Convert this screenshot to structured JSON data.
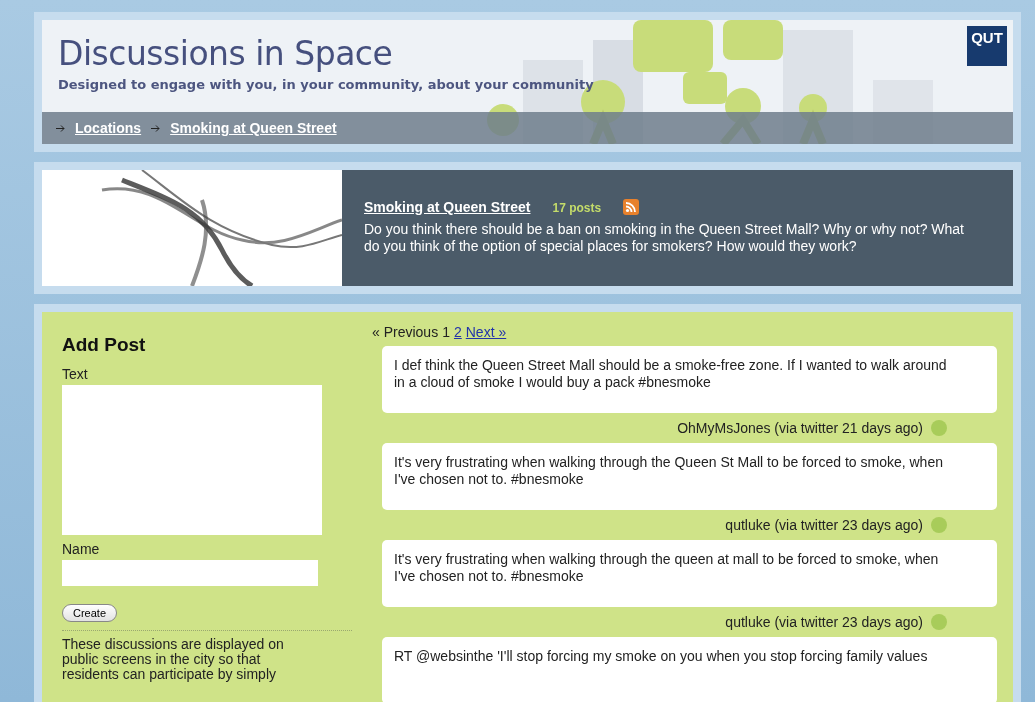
{
  "header": {
    "title": "Discussions in Space",
    "tagline": "Designed to engage with you, in your community, about your community",
    "logo": "QUT"
  },
  "breadcrumbs": [
    {
      "label": "Locations"
    },
    {
      "label": "Smoking at Queen Street"
    }
  ],
  "topic": {
    "title": "Smoking at Queen Street",
    "post_count": "17 posts",
    "question": "Do you think there should be a ban on smoking in the Queen Street Mall? Why or why not? What do you think of the option of special places for smokers? How would they work?"
  },
  "add_post": {
    "heading": "Add Post",
    "fields": [
      {
        "label": "Text",
        "kind": "textarea"
      },
      {
        "label": "Name",
        "kind": "input"
      }
    ],
    "button": "Create",
    "info": "These discussions are displayed on public screens in the city so that residents can participate by simply"
  },
  "pagination": {
    "previous": "« Previous",
    "pages": [
      {
        "label": "1",
        "selected": true
      },
      {
        "label": "2",
        "selected": false
      }
    ],
    "next": "Next »"
  },
  "posts": [
    {
      "text": "I def think the Queen Street Mall should be a smoke-free zone. If I wanted to walk around in a cloud of smoke I would buy a pack #bnesmoke",
      "author": "OhMyMsJones (via twitter 21 days ago)"
    },
    {
      "text": "It's very frustrating when walking through the Queen St Mall to be forced to smoke, when I've chosen not to. #bnesmoke",
      "author": "qutluke (via twitter 23 days ago)"
    },
    {
      "text": "It's very frustrating when walking through the queen at mall to be forced to smoke, when I've chosen not to. #bnesmoke",
      "author": "qutluke (via twitter 23 days ago)"
    },
    {
      "text": "RT @websinthe 'I'll stop forcing my smoke on you when you stop forcing family values"
    }
  ]
}
